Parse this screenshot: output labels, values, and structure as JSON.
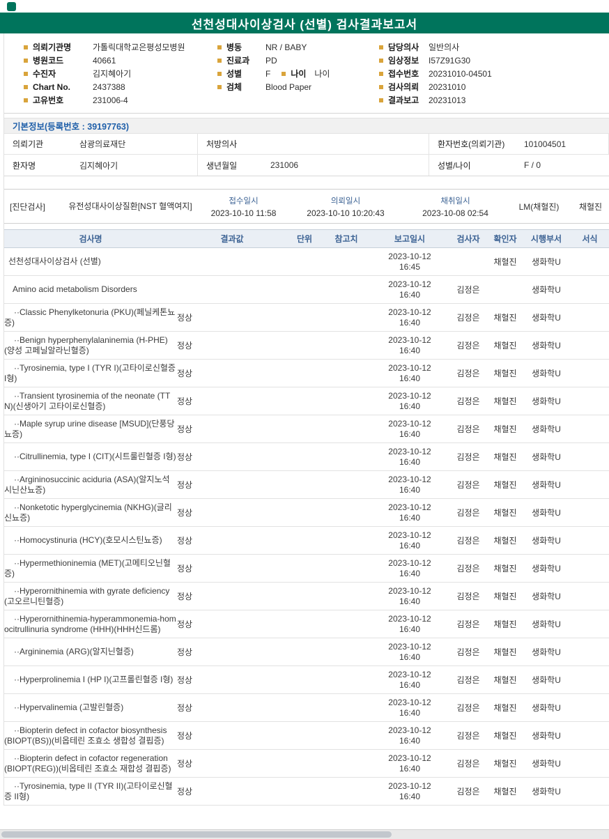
{
  "colors": {
    "header_bg": "#00745c",
    "section_title": "#1f5fa9",
    "table_header_text": "#3d6394",
    "table_header_bg": "#eaeff5",
    "bullet": "#d9a43b"
  },
  "title": "선천성대사이상검사 (선별) 검사결과보고서",
  "header_info": {
    "col1": [
      {
        "label": "의뢰기관명",
        "value": "가톨릭대학교은평성모병원"
      },
      {
        "label": "병원코드",
        "value": "40661"
      },
      {
        "label": "수진자",
        "value": "김지혜아기"
      },
      {
        "label": "Chart No.",
        "value": "2437388"
      },
      {
        "label": "고유번호",
        "value": "231006-4"
      }
    ],
    "col2": [
      {
        "label": "병동",
        "value": "NR / BABY"
      },
      {
        "label": "진료과",
        "value": "PD"
      },
      {
        "label": "성별",
        "value": "F",
        "label2": "나이",
        "value2": "나이"
      },
      {
        "label": "검체",
        "value": "Blood Paper"
      }
    ],
    "col3": [
      {
        "label": "담당의사",
        "value": "일반의사"
      },
      {
        "label": "임상정보",
        "value": "I57Z91G30"
      },
      {
        "label": "접수번호",
        "value": "20231010-04501"
      },
      {
        "label": "검사의뢰",
        "value": "20231010"
      },
      {
        "label": "결과보고",
        "value": "20231013"
      }
    ]
  },
  "basic_info": {
    "section_title": "기본정보(등록번호 : 39197763)",
    "rows": [
      [
        {
          "label": "의뢰기관",
          "value": "삼광의료재단"
        },
        {
          "label": "처방의사",
          "value": ""
        },
        {
          "label": "환자번호(의뢰기관)",
          "value": "101004501"
        }
      ],
      [
        {
          "label": "환자명",
          "value": "김지혜아기"
        },
        {
          "label": "생년월일",
          "value": "231006"
        },
        {
          "label": "성별/나이",
          "value": "F / 0"
        }
      ]
    ]
  },
  "order": {
    "tag": "[진단검사]",
    "test_name": "유전성대사이상질환[NST 혈액여지]",
    "receipt_label": "접수일시",
    "receipt_value": "2023-10-10 11:58",
    "request_label": "의뢰일시",
    "request_value": "2023-10-10 10:20:43",
    "collect_label": "채취일시",
    "collect_value": "2023-10-08 02:54",
    "collector": "LM(채혈진)",
    "confirmer": "채혈진"
  },
  "results": {
    "headers": [
      "검사명",
      "결과값",
      "단위",
      "참고치",
      "보고일시",
      "검사자",
      "확인자",
      "시행부서",
      "서식"
    ],
    "rows": [
      {
        "name": "선천성대사이상검사 (선별)",
        "level": 0,
        "result": "",
        "unit": "",
        "ref": "",
        "date": "2023-10-12",
        "time": "16:45",
        "tester": "",
        "confirmer": "채혈진",
        "dept": "생화학U",
        "form": ""
      },
      {
        "name": "Amino acid metabolism Disorders",
        "level": 1,
        "result": "",
        "unit": "",
        "ref": "",
        "date": "2023-10-12",
        "time": "16:40",
        "tester": "김정은",
        "confirmer": "",
        "dept": "생화학U",
        "form": ""
      },
      {
        "name": "··Classic Phenylketonuria (PKU)(페닐케톤뇨증)",
        "level": 2,
        "result": "정상",
        "unit": "",
        "ref": "",
        "date": "2023-10-12",
        "time": "16:40",
        "tester": "김정은",
        "confirmer": "채혈진",
        "dept": "생화학U",
        "form": ""
      },
      {
        "name": "··Benign hyperphenylalaninemia (H-PHE)(양성 고페닐알라닌혈증)",
        "level": 2,
        "result": "정상",
        "unit": "",
        "ref": "",
        "date": "2023-10-12",
        "time": "16:40",
        "tester": "김정은",
        "confirmer": "채혈진",
        "dept": "생화학U",
        "form": ""
      },
      {
        "name": "··Tyrosinemia, type I (TYR I)(고타이로신혈증 I형)",
        "level": 2,
        "result": "정상",
        "unit": "",
        "ref": "",
        "date": "2023-10-12",
        "time": "16:40",
        "tester": "김정은",
        "confirmer": "채혈진",
        "dept": "생화학U",
        "form": ""
      },
      {
        "name": "··Transient tyrosinemia of the neonate (TTN)(신생아기 고타이로신혈증)",
        "level": 2,
        "result": "정상",
        "unit": "",
        "ref": "",
        "date": "2023-10-12",
        "time": "16:40",
        "tester": "김정은",
        "confirmer": "채혈진",
        "dept": "생화학U",
        "form": ""
      },
      {
        "name": "··Maple syrup urine disease [MSUD](단풍당뇨증)",
        "level": 2,
        "result": "정상",
        "unit": "",
        "ref": "",
        "date": "2023-10-12",
        "time": "16:40",
        "tester": "김정은",
        "confirmer": "채혈진",
        "dept": "생화학U",
        "form": ""
      },
      {
        "name": "··Citrullinemia, type I (CIT)(시트룰린혈증 I형)",
        "level": 2,
        "result": "정상",
        "unit": "",
        "ref": "",
        "date": "2023-10-12",
        "time": "16:40",
        "tester": "김정은",
        "confirmer": "채혈진",
        "dept": "생화학U",
        "form": ""
      },
      {
        "name": "··Argininosuccinic aciduria (ASA)(알지노석시닌산뇨증)",
        "level": 2,
        "result": "정상",
        "unit": "",
        "ref": "",
        "date": "2023-10-12",
        "time": "16:40",
        "tester": "김정은",
        "confirmer": "채혈진",
        "dept": "생화학U",
        "form": ""
      },
      {
        "name": "··Nonketotic hyperglycinemia (NKHG)(글리신뇨증)",
        "level": 2,
        "result": "정상",
        "unit": "",
        "ref": "",
        "date": "2023-10-12",
        "time": "16:40",
        "tester": "김정은",
        "confirmer": "채혈진",
        "dept": "생화학U",
        "form": ""
      },
      {
        "name": "··Homocystinuria (HCY)(호모시스틴뇨증)",
        "level": 2,
        "result": "정상",
        "unit": "",
        "ref": "",
        "date": "2023-10-12",
        "time": "16:40",
        "tester": "김정은",
        "confirmer": "채혈진",
        "dept": "생화학U",
        "form": ""
      },
      {
        "name": "··Hypermethioninemia (MET)(고메티오닌혈증)",
        "level": 2,
        "result": "정상",
        "unit": "",
        "ref": "",
        "date": "2023-10-12",
        "time": "16:40",
        "tester": "김정은",
        "confirmer": "채혈진",
        "dept": "생화학U",
        "form": ""
      },
      {
        "name": "··Hyperornithinemia with gyrate deficiency(고오르니틴혈증)",
        "level": 2,
        "result": "정상",
        "unit": "",
        "ref": "",
        "date": "2023-10-12",
        "time": "16:40",
        "tester": "김정은",
        "confirmer": "채혈진",
        "dept": "생화학U",
        "form": ""
      },
      {
        "name": "··Hyperornithinemia-hyperammonemia-homocitrullinuria syndrome (HHH)(HHH신드롬)",
        "level": 2,
        "result": "정상",
        "unit": "",
        "ref": "",
        "date": "2023-10-12",
        "time": "16:40",
        "tester": "김정은",
        "confirmer": "채혈진",
        "dept": "생화학U",
        "form": ""
      },
      {
        "name": "··Argininemia (ARG)(알지닌혈증)",
        "level": 2,
        "result": "정상",
        "unit": "",
        "ref": "",
        "date": "2023-10-12",
        "time": "16:40",
        "tester": "김정은",
        "confirmer": "채혈진",
        "dept": "생화학U",
        "form": ""
      },
      {
        "name": "··Hyperprolinemia I (HP I)(고프롤린혈증 I형)",
        "level": 2,
        "result": "정상",
        "unit": "",
        "ref": "",
        "date": "2023-10-12",
        "time": "16:40",
        "tester": "김정은",
        "confirmer": "채혈진",
        "dept": "생화학U",
        "form": ""
      },
      {
        "name": "··Hypervalinemia (고발린혈증)",
        "level": 2,
        "result": "정상",
        "unit": "",
        "ref": "",
        "date": "2023-10-12",
        "time": "16:40",
        "tester": "김정은",
        "confirmer": "채혈진",
        "dept": "생화학U",
        "form": ""
      },
      {
        "name": "··Biopterin defect in cofactor biosynthesis (BIOPT(BS))(비옵테린 조효소 생합성 결핍증)",
        "level": 2,
        "result": "정상",
        "unit": "",
        "ref": "",
        "date": "2023-10-12",
        "time": "16:40",
        "tester": "김정은",
        "confirmer": "채혈진",
        "dept": "생화학U",
        "form": ""
      },
      {
        "name": "··Biopterin defect in cofactor regeneration (BIOPT(REG))(비옵테린 조효소 재합성 결핍증)",
        "level": 2,
        "result": "정상",
        "unit": "",
        "ref": "",
        "date": "2023-10-12",
        "time": "16:40",
        "tester": "김정은",
        "confirmer": "채혈진",
        "dept": "생화학U",
        "form": ""
      },
      {
        "name": "··Tyrosinemia, type II (TYR II)(고타이로신혈증 II형)",
        "level": 2,
        "result": "정상",
        "unit": "",
        "ref": "",
        "date": "2023-10-12",
        "time": "16:40",
        "tester": "김정은",
        "confirmer": "채혈진",
        "dept": "생화학U",
        "form": ""
      }
    ]
  }
}
